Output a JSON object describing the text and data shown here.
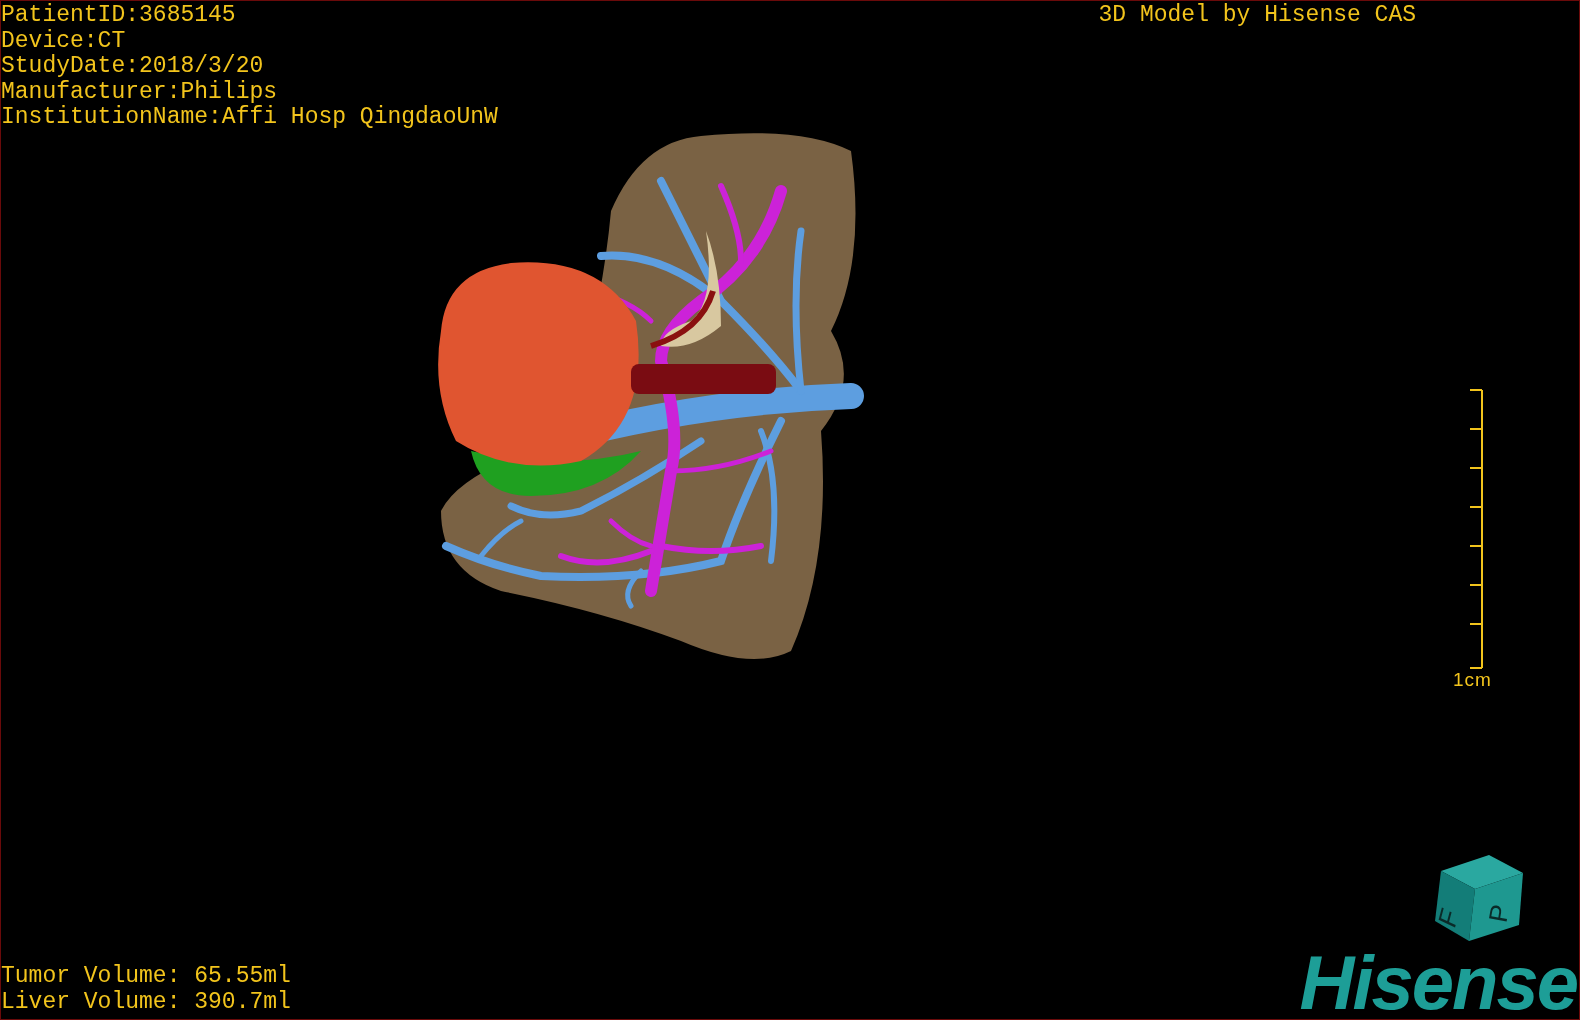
{
  "info_lines": [
    "PatientID:3685145",
    "Device:CT",
    "StudyDate:2018/3/20",
    "Manufacturer:Philips",
    "InstitutionName:Affi Hosp QingdaoUnW"
  ],
  "title": "3D Model by Hisense CAS",
  "scale_bar": {
    "label": "1cm"
  },
  "orientation_cube": {
    "faces": [
      "F",
      "P"
    ]
  },
  "volumes": [
    "Tumor Volume: 65.55ml",
    "Liver Volume: 390.7ml"
  ],
  "logo": {
    "text": "Hisense"
  }
}
